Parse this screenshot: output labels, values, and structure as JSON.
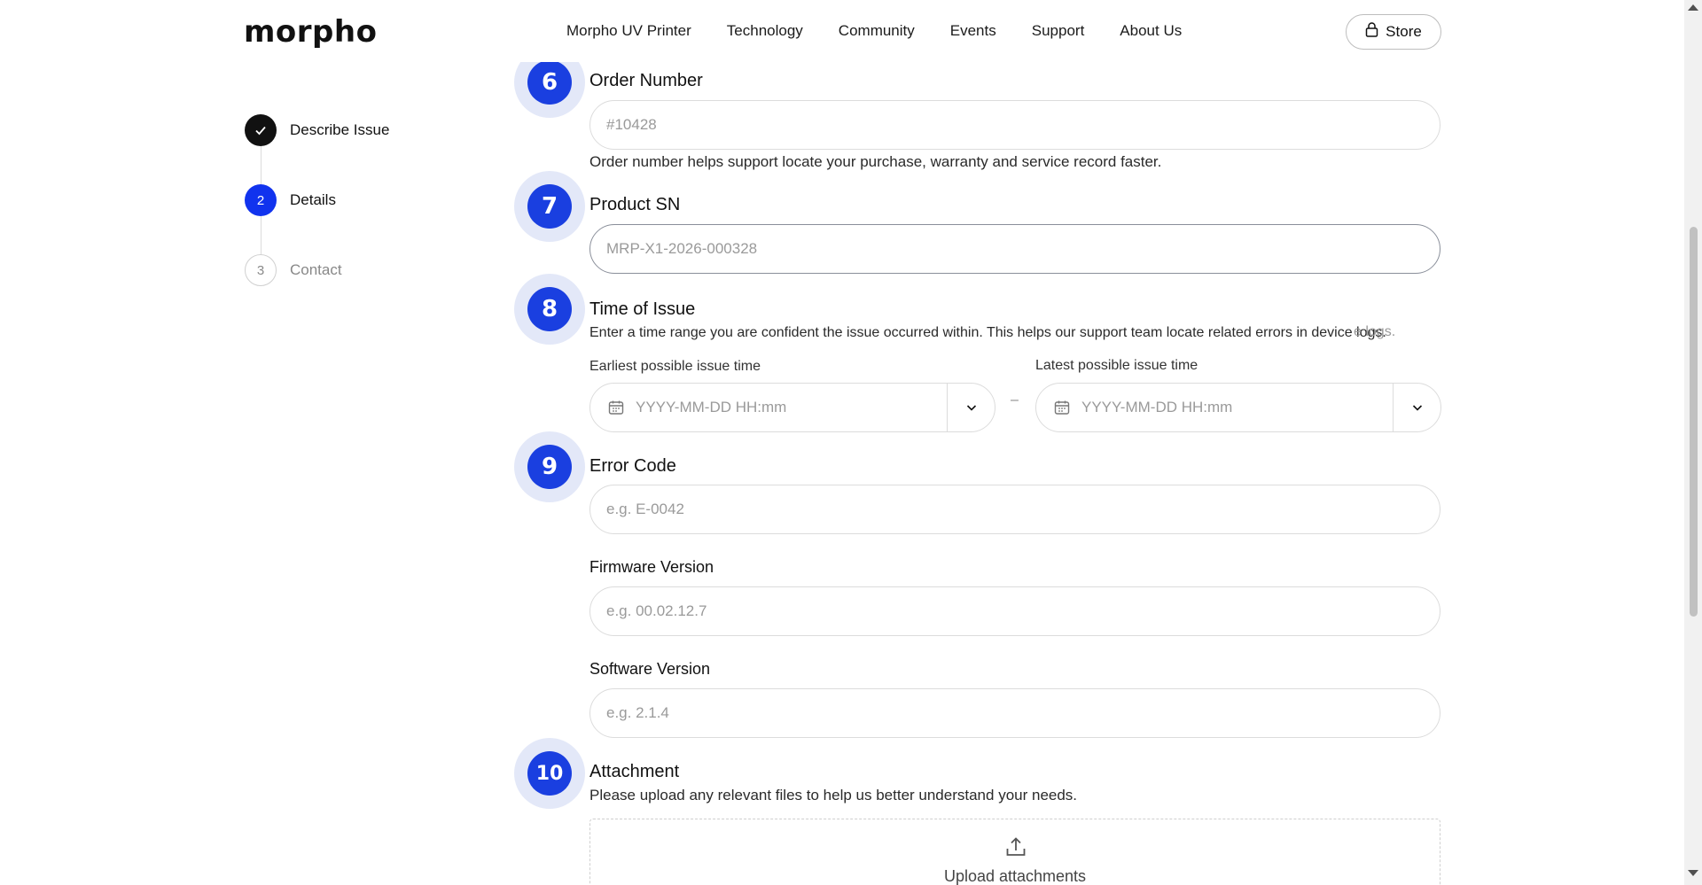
{
  "header": {
    "logo": "morpho",
    "nav": [
      "Morpho UV Printer",
      "Technology",
      "Community",
      "Events",
      "Support",
      "About Us"
    ],
    "store_label": "Store"
  },
  "stepper": {
    "steps": [
      {
        "label": "Describe Issue",
        "status": "done",
        "marker": ""
      },
      {
        "label": "Details",
        "status": "active",
        "marker": "2"
      },
      {
        "label": "Contact",
        "status": "todo",
        "marker": "3"
      }
    ]
  },
  "form": {
    "order": {
      "number": "6",
      "title": "Order Number",
      "placeholder": "#10428",
      "help": "Order number helps support locate your purchase, warranty and service record faster."
    },
    "serial": {
      "number": "7",
      "title": "Product SN",
      "placeholder": "MRP-X1-2026-000328"
    },
    "time": {
      "number": "8",
      "title": "Time of Issue",
      "help": "Enter a time range you are confident the issue occurred within. This helps our support team locate related errors in device logs.",
      "overflow": "e logs.",
      "earliest_label": "Earliest possible issue time",
      "latest_label": "Latest possible issue time",
      "earliest_placeholder": "YYYY-MM-DD HH:mm",
      "latest_placeholder": "YYYY-MM-DD HH:mm",
      "separator": "–"
    },
    "error": {
      "number": "9",
      "title": "Error Code",
      "placeholder": "e.g. E-0042"
    },
    "firmware": {
      "title": "Firmware Version",
      "placeholder": "e.g. 00.02.12.7"
    },
    "software": {
      "title": "Software Version",
      "placeholder": "e.g. 2.1.4"
    },
    "attachment": {
      "number": "10",
      "title": "Attachment",
      "help": "Please upload any relevant files to help us better understand your needs.",
      "upload_label": "Upload attachments"
    }
  },
  "colors": {
    "accent": "#1a3fe0",
    "badge_ring": "#e3e8f8",
    "step_done": "#111111",
    "step_active": "#1133ee"
  },
  "icons": [
    "lock-icon",
    "check-icon",
    "calendar-icon",
    "chevron-down-icon",
    "upload-icon"
  ]
}
